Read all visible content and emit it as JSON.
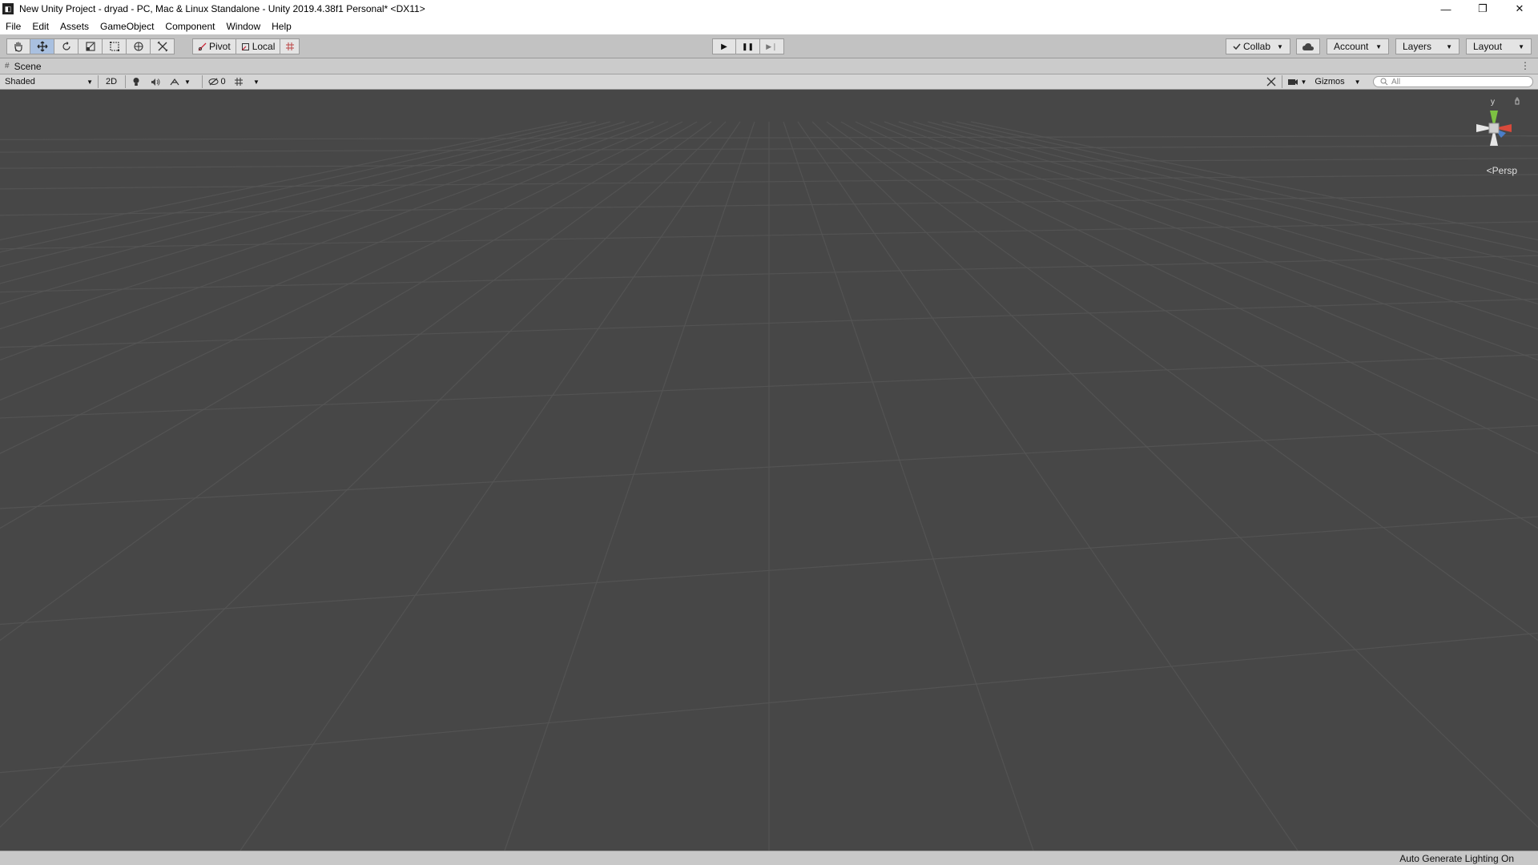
{
  "window": {
    "title": "New Unity Project - dryad - PC, Mac & Linux Standalone - Unity 2019.4.38f1 Personal* <DX11>",
    "app_icon_glyph": "◧",
    "minimize": "—",
    "restore": "❐",
    "close": "✕"
  },
  "menu": [
    "File",
    "Edit",
    "Assets",
    "GameObject",
    "Component",
    "Window",
    "Help"
  ],
  "toolbar": {
    "pivot_label": "Pivot",
    "local_label": "Local",
    "collab_label": "Collab",
    "account_label": "Account",
    "layers_label": "Layers",
    "layout_label": "Layout",
    "play_glyph": "▶",
    "pause_glyph": "❚❚",
    "step_glyph": "▶❘"
  },
  "scene_tab": {
    "label": "Scene",
    "menu_glyph": "⋮"
  },
  "scene_toolbar": {
    "draw_mode": "Shaded",
    "mode_2d": "2D",
    "hidden_count": "0",
    "gizmos_label": "Gizmos",
    "search_placeholder": "All"
  },
  "viewport": {
    "projection_label": "Persp",
    "axis_y_label": "y",
    "background_color": "#474747",
    "grid_color": "#555555"
  },
  "status": {
    "text": "Auto Generate Lighting On"
  },
  "colors": {
    "toolbar_bg": "#c2c2c2",
    "active_tool": "#a9c0e0",
    "gizmo_y": "#7dc142",
    "gizmo_x": "#d84a3b",
    "gizmo_z": "#4a7ec9"
  }
}
